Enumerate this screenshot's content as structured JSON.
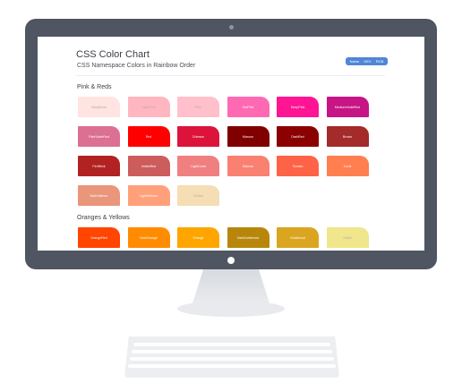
{
  "page": {
    "title": "CSS Color Chart",
    "subtitle": "CSS Namespace Colors in Rainbow Order"
  },
  "format_toggle": [
    "Name",
    "HEX",
    "RGB"
  ],
  "sections": [
    {
      "heading": "Pink & Reds",
      "swatches": [
        {
          "name": "MistyRose",
          "color": "#FFE4E1",
          "text": "light"
        },
        {
          "name": "LightPink",
          "color": "#FFB6C1",
          "text": "light"
        },
        {
          "name": "Pink",
          "color": "#FFC0CB",
          "text": "light"
        },
        {
          "name": "HotPink",
          "color": "#FF69B4",
          "text": "dark"
        },
        {
          "name": "DeepPink",
          "color": "#FF1493",
          "text": "dark"
        },
        {
          "name": "MediumVioletRed",
          "color": "#C71585",
          "text": "dark"
        },
        {
          "name": "PaleVioletRed",
          "color": "#DB7093",
          "text": "dark"
        },
        {
          "name": "Red",
          "color": "#FF0000",
          "text": "dark"
        },
        {
          "name": "Crimson",
          "color": "#DC143C",
          "text": "dark"
        },
        {
          "name": "Maroon",
          "color": "#800000",
          "text": "dark"
        },
        {
          "name": "DarkRed",
          "color": "#8B0000",
          "text": "dark"
        },
        {
          "name": "Brown",
          "color": "#A52A2A",
          "text": "dark"
        },
        {
          "name": "FireBrick",
          "color": "#B22222",
          "text": "dark"
        },
        {
          "name": "IndianRed",
          "color": "#CD5C5C",
          "text": "dark"
        },
        {
          "name": "LightCoral",
          "color": "#F08080",
          "text": "dark"
        },
        {
          "name": "Salmon",
          "color": "#FA8072",
          "text": "dark"
        },
        {
          "name": "Tomato",
          "color": "#FF6347",
          "text": "dark"
        },
        {
          "name": "Coral",
          "color": "#FF7F50",
          "text": "dark"
        },
        {
          "name": "DarkSalmon",
          "color": "#E9967A",
          "text": "dark"
        },
        {
          "name": "LightSalmon",
          "color": "#FFA07A",
          "text": "dark"
        },
        {
          "name": "Wheat",
          "color": "#F5DEB3",
          "text": "light"
        }
      ]
    },
    {
      "heading": "Oranges & Yellows",
      "swatches": [
        {
          "name": "OrangeRed",
          "color": "#FF4500",
          "text": "dark"
        },
        {
          "name": "DarkOrange",
          "color": "#FF8C00",
          "text": "dark"
        },
        {
          "name": "Orange",
          "color": "#FFA500",
          "text": "dark"
        },
        {
          "name": "DarkGoldenrod",
          "color": "#B8860B",
          "text": "dark"
        },
        {
          "name": "Goldenrod",
          "color": "#DAA520",
          "text": "dark"
        },
        {
          "name": "Khaki",
          "color": "#F0E68C",
          "text": "light"
        }
      ]
    }
  ]
}
